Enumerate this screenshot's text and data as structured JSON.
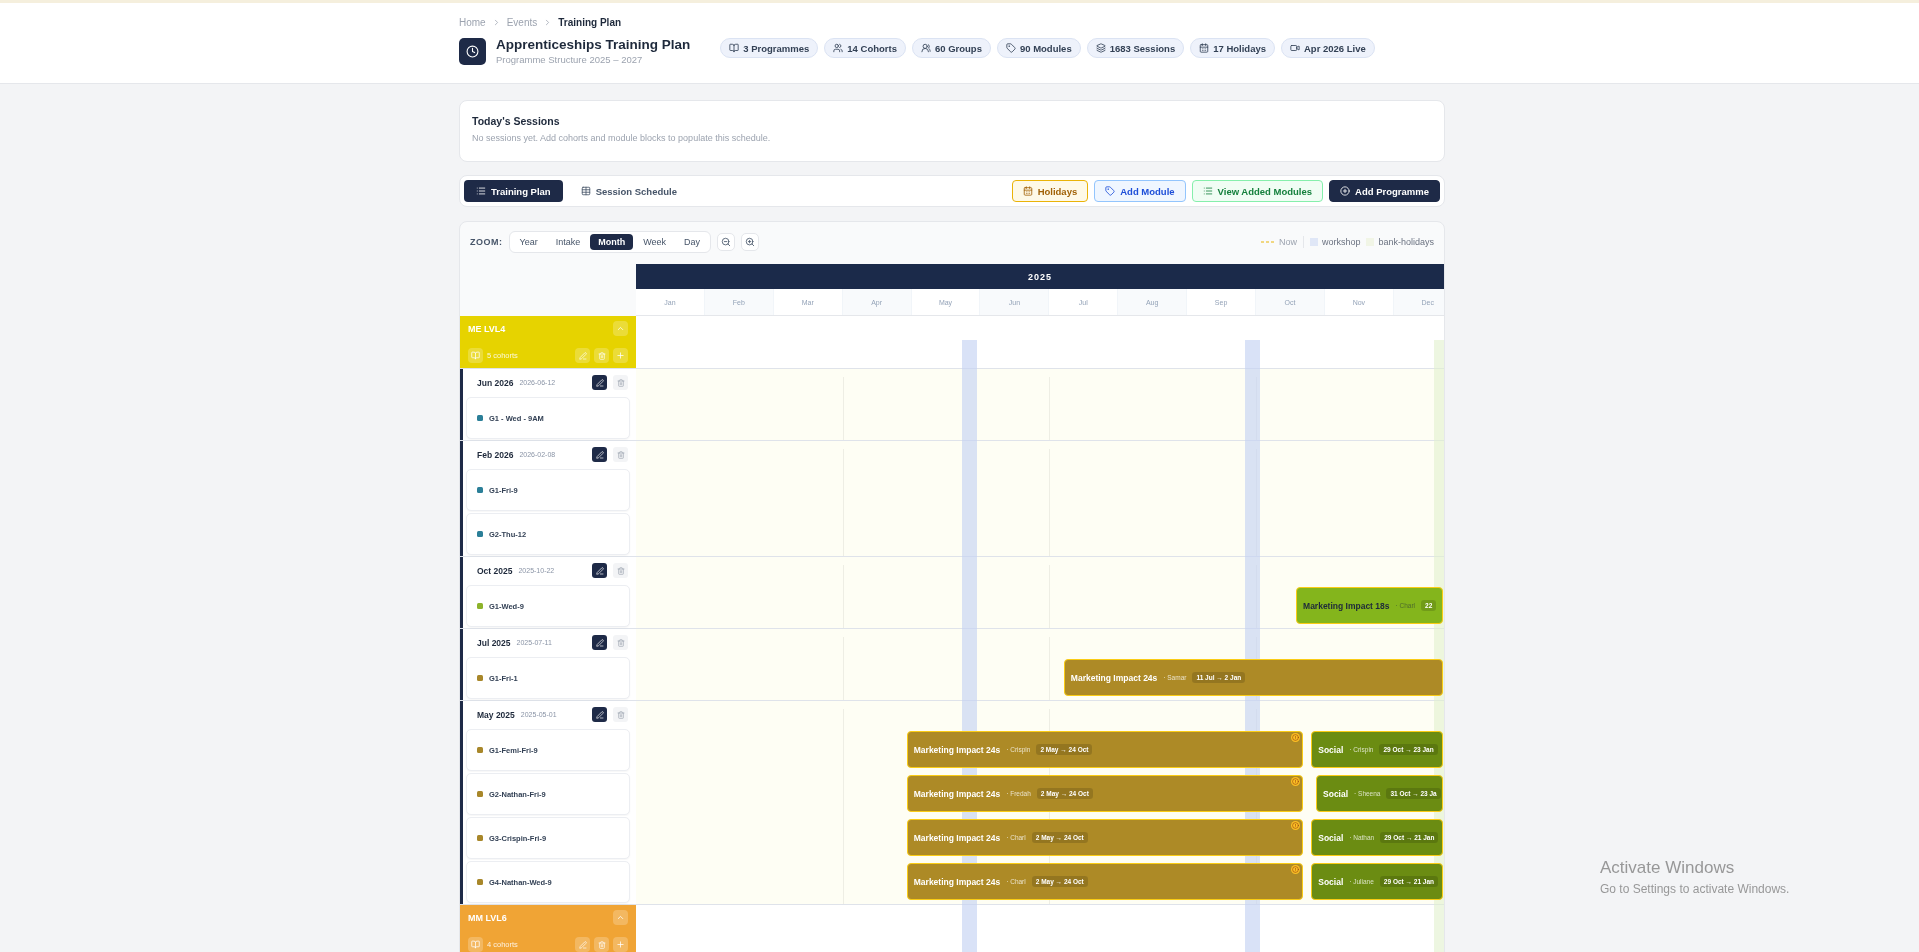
{
  "breadcrumb": [
    {
      "label": "Home",
      "current": false
    },
    {
      "label": "Events",
      "current": false
    },
    {
      "label": "Training Plan",
      "current": true
    }
  ],
  "header": {
    "title": "Apprenticeships Training Plan",
    "subtitle": "Programme Structure 2025 – 2027"
  },
  "stats": [
    {
      "label": "3 Programmes"
    },
    {
      "label": "14 Cohorts"
    },
    {
      "label": "60 Groups"
    },
    {
      "label": "90 Modules"
    },
    {
      "label": "1683 Sessions"
    },
    {
      "label": "17 Holidays"
    },
    {
      "label": "Apr 2026 Live"
    }
  ],
  "todays_sessions": {
    "title": "Today's Sessions",
    "message": "No sessions yet. Add cohorts and module blocks to populate this schedule."
  },
  "view_tabs": [
    {
      "label": "Training Plan",
      "selected": true
    },
    {
      "label": "Session Schedule",
      "selected": false
    }
  ],
  "actions": [
    {
      "label": "Holidays",
      "kind": "holidays"
    },
    {
      "label": "Add Module",
      "kind": "module"
    },
    {
      "label": "View Added Modules",
      "kind": "view"
    },
    {
      "label": "Add Programme",
      "kind": "primary"
    }
  ],
  "zoom": {
    "label": "ZOOM:",
    "options": [
      {
        "label": "Year",
        "selected": false
      },
      {
        "label": "Intake",
        "selected": false
      },
      {
        "label": "Month",
        "selected": true
      },
      {
        "label": "Week",
        "selected": false
      },
      {
        "label": "Day",
        "selected": false
      }
    ]
  },
  "legend": [
    {
      "label": "Now",
      "kind": "now"
    },
    {
      "label": "workshop",
      "kind": "workshop"
    },
    {
      "label": "bank-holidays",
      "kind": "holiday"
    }
  ],
  "timeline": {
    "year": "2025",
    "months": [
      "Jan",
      "Feb",
      "Mar",
      "Apr",
      "May",
      "Jun",
      "Jul",
      "Aug",
      "Sep",
      "Oct",
      "Nov",
      "Dec"
    ]
  },
  "programmes": [
    {
      "name": "ME LVL4",
      "color": "#e6d300",
      "summary": "5 cohorts",
      "expanded": true,
      "cohorts": [
        {
          "name": "Jun 2026",
          "date": "2026-06-12",
          "groups": [
            {
              "name": "G1 - Wed - 9AM",
              "color": "#2b7f98"
            }
          ]
        },
        {
          "name": "Feb 2026",
          "date": "2026-02-08",
          "groups": [
            {
              "name": "G1-Fri-9",
              "color": "#2b7f98"
            },
            {
              "name": "G2-Thu-12",
              "color": "#2b7f98"
            }
          ]
        },
        {
          "name": "Oct 2025",
          "date": "2025-10-22",
          "groups": [
            {
              "name": "G1-Wed-9",
              "color": "#8db32b",
              "bars": [
                {
                  "title": "Marketing Impact 18s",
                  "tutor": "· Charl",
                  "dates": "22",
                  "color": "#84b51c",
                  "warning": false
                }
              ]
            }
          ]
        },
        {
          "name": "Jul 2025",
          "date": "2025-07-11",
          "groups": [
            {
              "name": "G1-Fri-1",
              "color": "#a8872a",
              "bars": [
                {
                  "title": "Marketing Impact 24s",
                  "tutor": "· Samar",
                  "dates": "11 Jul → 2 Jan",
                  "color": "#ad8a26",
                  "warning": false
                }
              ]
            }
          ]
        },
        {
          "name": "May 2025",
          "date": "2025-05-01",
          "groups": [
            {
              "name": "G1-Femi-Fri-9",
              "color": "#a8872a",
              "bars": [
                {
                  "title": "Marketing Impact 24s",
                  "tutor": "· Crispin",
                  "dates": "2 May → 24 Oct",
                  "color": "#ad8a26",
                  "warning": true
                },
                {
                  "title": "Social",
                  "tutor": "· Crispin",
                  "dates": "29 Oct → 23 Jan",
                  "color": "#6b8c12",
                  "warning": false
                }
              ]
            },
            {
              "name": "G2-Nathan-Fri-9",
              "color": "#a8872a",
              "bars": [
                {
                  "title": "Marketing Impact 24s",
                  "tutor": "· Fredah",
                  "dates": "2 May → 24 Oct",
                  "color": "#ad8a26",
                  "warning": true
                },
                {
                  "title": "Social",
                  "tutor": "· Sheena",
                  "dates": "31 Oct → 23 Ja",
                  "color": "#6b8c12",
                  "warning": false
                }
              ]
            },
            {
              "name": "G3-Crispin-Fri-9",
              "color": "#a8872a",
              "bars": [
                {
                  "title": "Marketing Impact 24s",
                  "tutor": "· Charl",
                  "dates": "2 May → 24 Oct",
                  "color": "#ad8a26",
                  "warning": true
                },
                {
                  "title": "Social",
                  "tutor": "· Nathan",
                  "dates": "29 Oct → 21 Jan",
                  "color": "#6b8c12",
                  "warning": false
                }
              ]
            },
            {
              "name": "G4-Nathan-Wed-9",
              "color": "#a8872a",
              "bars": [
                {
                  "title": "Marketing Impact 24s",
                  "tutor": "· Charl",
                  "dates": "2 May → 24 Oct",
                  "color": "#ad8a26",
                  "warning": true
                },
                {
                  "title": "Social",
                  "tutor": "· Juliane",
                  "dates": "29 Oct → 21 Jan",
                  "color": "#6b8c12",
                  "warning": false
                }
              ]
            }
          ]
        }
      ]
    },
    {
      "name": "MM LVL6",
      "color": "#f0a435",
      "summary": "4 cohorts",
      "expanded": true
    }
  ],
  "os_notice": {
    "title": "Activate Windows",
    "subtitle": "Go to Settings to activate Windows."
  }
}
